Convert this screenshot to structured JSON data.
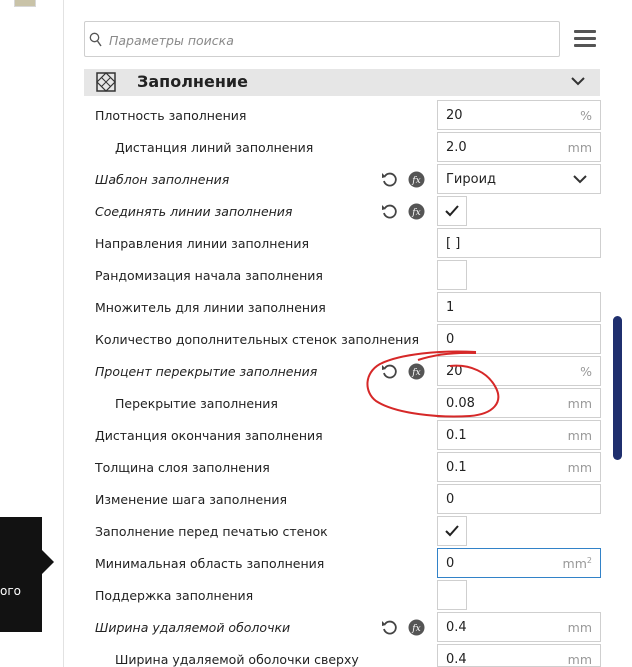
{
  "search": {
    "placeholder": "Параметры поиска"
  },
  "category": {
    "title": "Заполнение"
  },
  "tooltip": {
    "text": "ого"
  },
  "rows": [
    {
      "label": "Плотность заполнения",
      "value": "20",
      "unit": "%"
    },
    {
      "label": "Дистанция линий заполнения",
      "value": "2.0",
      "unit": "mm"
    },
    {
      "label": "Шаблон заполнения",
      "value": "Гироид"
    },
    {
      "label": "Соединять линии заполнения",
      "checked": true
    },
    {
      "label": "Направления линии заполнения",
      "value": "[ ]"
    },
    {
      "label": "Рандомизация начала заполнения",
      "checked": false
    },
    {
      "label": "Множитель для линии заполнения",
      "value": "1"
    },
    {
      "label": "Количество дополнительных стенок заполнения",
      "value": "0"
    },
    {
      "label": "Процент перекрытие заполнения",
      "value": "20",
      "unit": "%"
    },
    {
      "label": "Перекрытие заполнения",
      "value": "0.08",
      "unit": "mm"
    },
    {
      "label": "Дистанция окончания заполнения",
      "value": "0.1",
      "unit": "mm"
    },
    {
      "label": "Толщина слоя заполнения",
      "value": "0.1",
      "unit": "mm"
    },
    {
      "label": "Изменение шага заполнения",
      "value": "0"
    },
    {
      "label": "Заполнение перед печатью стенок",
      "checked": true
    },
    {
      "label": "Минимальная область заполнения",
      "value": "0",
      "unit": "mm",
      "unit_sup": "2"
    },
    {
      "label": "Поддержка заполнения",
      "checked": false
    },
    {
      "label": "Ширина удаляемой оболочки",
      "value": "0.4",
      "unit": "mm"
    },
    {
      "label": "Ширина удаляемой оболочки сверху",
      "value": "0.4",
      "unit": "mm"
    }
  ],
  "colors": {
    "accent_focus": "#3282c8",
    "scrollbar": "#1f2f6e",
    "annotation": "#d62828"
  }
}
